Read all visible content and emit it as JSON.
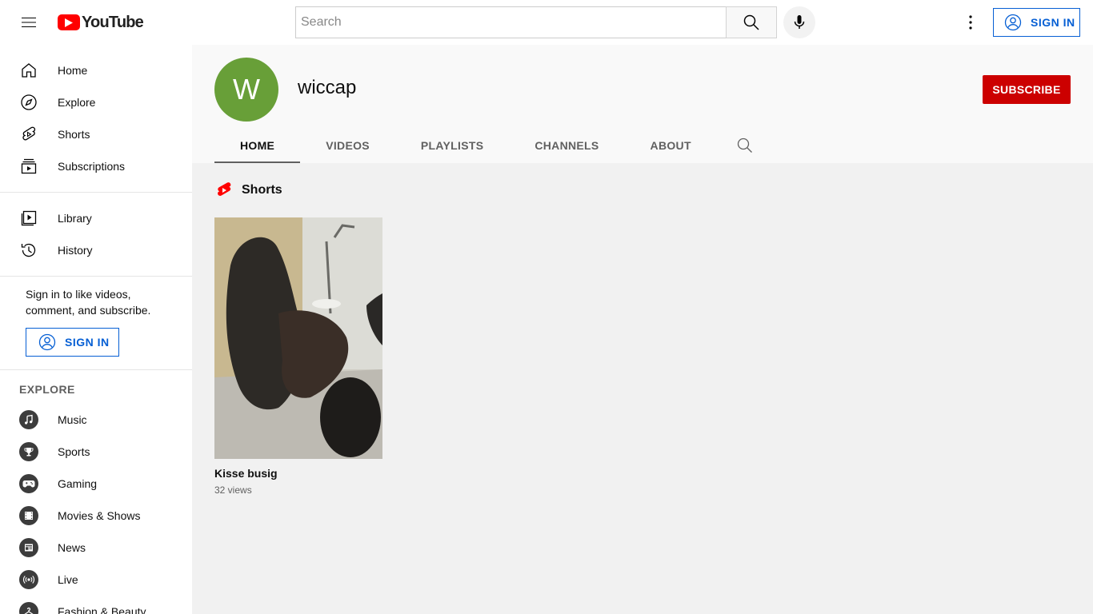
{
  "masthead": {
    "logo_text": "YouTube",
    "search_placeholder": "Search",
    "search_value": "",
    "sign_in_label": "SIGN IN"
  },
  "sidebar": {
    "main": [
      {
        "label": "Home",
        "icon": "home-icon"
      },
      {
        "label": "Explore",
        "icon": "compass-icon"
      },
      {
        "label": "Shorts",
        "icon": "shorts-icon"
      },
      {
        "label": "Subscriptions",
        "icon": "subscriptions-icon"
      }
    ],
    "library": [
      {
        "label": "Library",
        "icon": "library-icon"
      },
      {
        "label": "History",
        "icon": "history-icon"
      }
    ],
    "signin_prompt": "Sign in to like videos, comment, and subscribe.",
    "signin_label": "SIGN IN",
    "explore_title": "EXPLORE",
    "explore": [
      {
        "label": "Music",
        "icon": "music-icon"
      },
      {
        "label": "Sports",
        "icon": "trophy-icon"
      },
      {
        "label": "Gaming",
        "icon": "gamepad-icon"
      },
      {
        "label": "Movies & Shows",
        "icon": "film-icon"
      },
      {
        "label": "News",
        "icon": "newspaper-icon"
      },
      {
        "label": "Live",
        "icon": "live-icon"
      },
      {
        "label": "Fashion & Beauty",
        "icon": "hanger-icon"
      }
    ]
  },
  "channel": {
    "avatar_letter": "W",
    "avatar_color": "#689f38",
    "name": "wiccap",
    "subscribe_label": "SUBSCRIBE",
    "tabs": [
      "HOME",
      "VIDEOS",
      "PLAYLISTS",
      "CHANNELS",
      "ABOUT"
    ],
    "active_tab": "HOME"
  },
  "shelf": {
    "title": "Shorts",
    "items": [
      {
        "title": "Kisse busig",
        "views": "32 views"
      }
    ]
  },
  "colors": {
    "brand_red": "#ff0000",
    "subscribe_red": "#cc0000",
    "link_blue": "#065fd4"
  }
}
